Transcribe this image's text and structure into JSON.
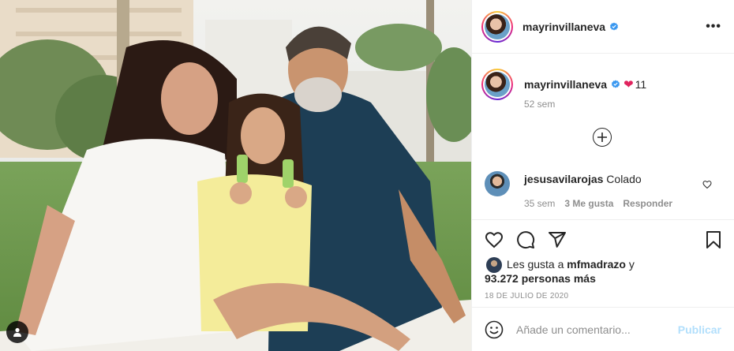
{
  "post": {
    "author": "mayrinvillaneva",
    "more_label": "•••",
    "caption": {
      "username": "mayrinvillaneva",
      "heart": "❤",
      "count": "11",
      "time": "52 sem"
    },
    "comments": [
      {
        "username": "jesusavilarojas",
        "text": "Colado",
        "time": "35 sem",
        "likes": "3 Me gusta",
        "reply": "Responder"
      }
    ],
    "likes": {
      "prefix": "Les gusta a",
      "user": "mfmadrazo",
      "joiner": "y",
      "others": "93.272 personas más"
    },
    "date": "18 DE JULIO DE 2020",
    "comment_box": {
      "placeholder": "Añade un comentario...",
      "publish": "Publicar"
    }
  },
  "icons": {
    "verified": "verified-badge-icon",
    "more": "more-options-icon",
    "add": "plus-circle-icon",
    "like": "heart-icon",
    "comment": "comment-icon",
    "share": "share-icon",
    "save": "bookmark-icon",
    "emoji": "smiley-icon",
    "tag": "user-tag-icon"
  },
  "colors": {
    "verified": "#3897f0",
    "link_disabled": "#b2dffc",
    "muted": "#8e8e8e",
    "heart_emoji": "#e0245e"
  }
}
